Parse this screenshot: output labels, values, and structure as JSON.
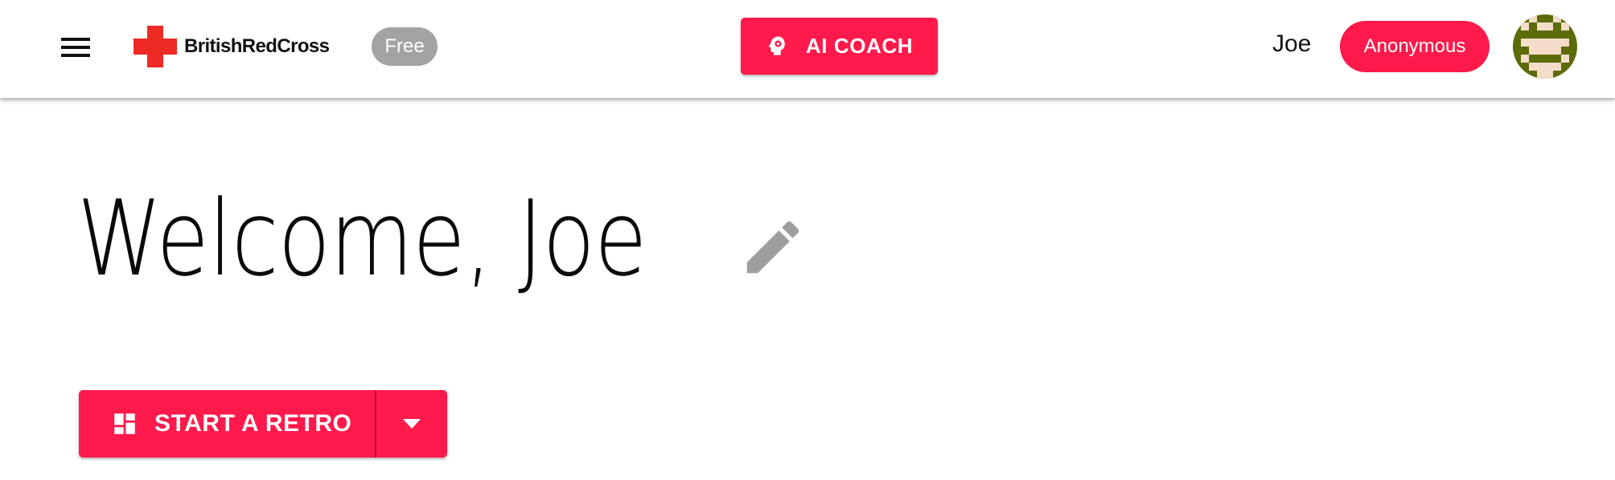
{
  "header": {
    "brand": "BritishRedCross",
    "plan_badge": "Free",
    "ai_coach_label": "AI COACH",
    "username": "Joe",
    "role_label": "Anonymous"
  },
  "main": {
    "welcome_text": "Welcome, Joe",
    "start_retro_label": "START A RETRO"
  },
  "icons": {
    "menu": "hamburger-menu-icon",
    "logo": "red-cross-icon",
    "coach": "head-gear-icon",
    "avatar": "pixel-avatar",
    "edit": "pencil-icon",
    "start": "dashboard-icon",
    "dropdown": "arrow-drop-down-icon"
  },
  "colors": {
    "accent": "#ff1a4b",
    "logo_red": "#ee2a24",
    "badge_gray": "#a3a3a3",
    "icon_gray": "#9e9e9e",
    "avatar_green": "#5b6b07",
    "avatar_skin": "#f3dcc8"
  }
}
